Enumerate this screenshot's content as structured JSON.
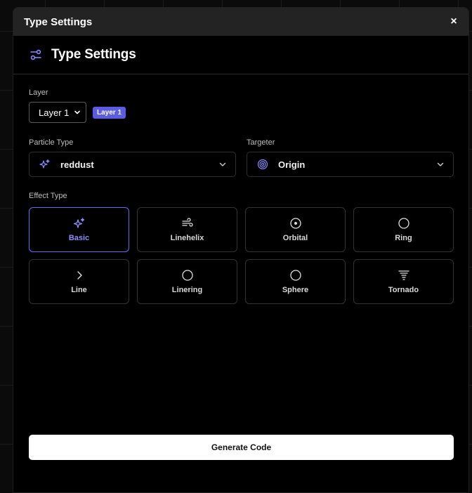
{
  "window": {
    "title": "Type Settings",
    "close_label": "×"
  },
  "header": {
    "title": "Type Settings",
    "icon": "sliders-icon"
  },
  "layer": {
    "label": "Layer",
    "selected": "Layer 1",
    "badge": "Layer 1"
  },
  "particle": {
    "label": "Particle Type",
    "value": "reddust",
    "icon": "sparkles-icon"
  },
  "targeter": {
    "label": "Targeter",
    "value": "Origin",
    "icon": "target-icon"
  },
  "effects": {
    "label": "Effect Type",
    "selected": "Basic",
    "items": [
      {
        "name": "Basic",
        "icon": "sparkles-icon"
      },
      {
        "name": "Linehelix",
        "icon": "wind-icon"
      },
      {
        "name": "Orbital",
        "icon": "circle-dot-icon"
      },
      {
        "name": "Ring",
        "icon": "circle-icon"
      },
      {
        "name": "Line",
        "icon": "chevron-right-icon"
      },
      {
        "name": "Linering",
        "icon": "circle-icon"
      },
      {
        "name": "Sphere",
        "icon": "circle-icon"
      },
      {
        "name": "Tornado",
        "icon": "tornado-icon"
      }
    ]
  },
  "actions": {
    "generate_label": "Generate Code"
  },
  "colors": {
    "accent": "#5b5be6",
    "accent_text": "#8f8ff8",
    "background": "#000000",
    "titlebar": "#232323"
  }
}
